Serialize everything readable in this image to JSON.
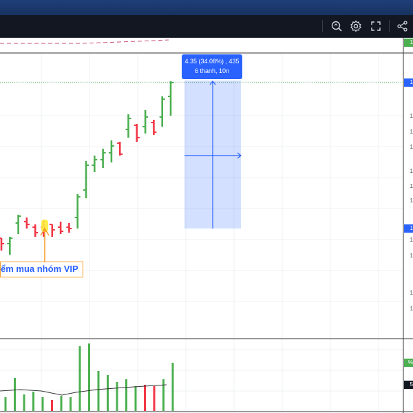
{
  "colors": {
    "accent": "#2962ff",
    "up": "#4caf50",
    "down": "#f23645",
    "annotation_border": "#f59a23",
    "marker": "#ffeb3b",
    "toolbar_bg": "#131722"
  },
  "toolbar": {
    "icons": [
      "zoom-search-icon",
      "gear-icon",
      "fullscreen-icon",
      "share-icon"
    ]
  },
  "measure": {
    "line1": "4.35 (34.08%) , 435",
    "line2": "6 thanh, 10n"
  },
  "annotation": {
    "text": "ểm mua nhóm VIP"
  },
  "price_axis": {
    "top_tag": "1",
    "mid_tag": "1",
    "right_tags": [
      "1",
      "1",
      "1",
      "1",
      "1",
      "1",
      "1",
      "1",
      "1",
      "1",
      "1"
    ],
    "volume_tags": [
      "%",
      "5"
    ]
  },
  "chart_data": {
    "type": "ohlc",
    "bars": [
      {
        "o": 346,
        "h": 346,
        "l": 364,
        "c": 354
      },
      {
        "o": 354,
        "h": 344,
        "l": 370,
        "c": 346
      },
      {
        "o": 324,
        "h": 312,
        "l": 340,
        "c": 314
      },
      {
        "o": 322,
        "h": 316,
        "l": 332,
        "c": 326
      },
      {
        "o": 330,
        "h": 326,
        "l": 344,
        "c": 338
      },
      {
        "o": 330,
        "h": 320,
        "l": 344,
        "c": 336
      },
      {
        "o": 326,
        "h": 326,
        "l": 344,
        "c": 334
      },
      {
        "o": 330,
        "h": 322,
        "l": 340,
        "c": 336
      },
      {
        "o": 330,
        "h": 324,
        "l": 338,
        "c": 332
      },
      {
        "o": 316,
        "h": 282,
        "l": 332,
        "c": 286
      },
      {
        "o": 276,
        "h": 234,
        "l": 288,
        "c": 240
      },
      {
        "o": 240,
        "h": 226,
        "l": 250,
        "c": 232
      },
      {
        "o": 232,
        "h": 216,
        "l": 244,
        "c": 222
      },
      {
        "o": 222,
        "h": 204,
        "l": 236,
        "c": 212
      },
      {
        "o": 208,
        "h": 206,
        "l": 226,
        "c": 224
      },
      {
        "o": 188,
        "h": 166,
        "l": 200,
        "c": 172
      },
      {
        "o": 182,
        "h": 180,
        "l": 206,
        "c": 200
      },
      {
        "o": 184,
        "h": 160,
        "l": 194,
        "c": 170
      },
      {
        "o": 178,
        "h": 174,
        "l": 196,
        "c": 192
      },
      {
        "o": 170,
        "h": 140,
        "l": 184,
        "c": 144
      },
      {
        "o": 140,
        "h": 118,
        "l": 168,
        "c": 120
      }
    ],
    "volume": [
      {
        "v": 20,
        "up": true
      },
      {
        "v": 48,
        "up": true
      },
      {
        "v": 24,
        "up": true
      },
      {
        "v": 28,
        "up": true
      },
      {
        "v": 20,
        "up": true
      },
      {
        "v": 16,
        "up": false
      },
      {
        "v": 22,
        "up": true
      },
      {
        "v": 20,
        "up": true
      },
      {
        "v": 94,
        "up": true
      },
      {
        "v": 98,
        "up": true
      },
      {
        "v": 58,
        "up": true
      },
      {
        "v": 52,
        "up": true
      },
      {
        "v": 42,
        "up": true
      },
      {
        "v": 46,
        "up": true
      },
      {
        "v": 36,
        "up": true
      },
      {
        "v": 38,
        "up": false
      },
      {
        "v": 36,
        "up": false
      },
      {
        "v": 46,
        "up": true
      },
      {
        "v": 70,
        "up": true
      }
    ]
  }
}
